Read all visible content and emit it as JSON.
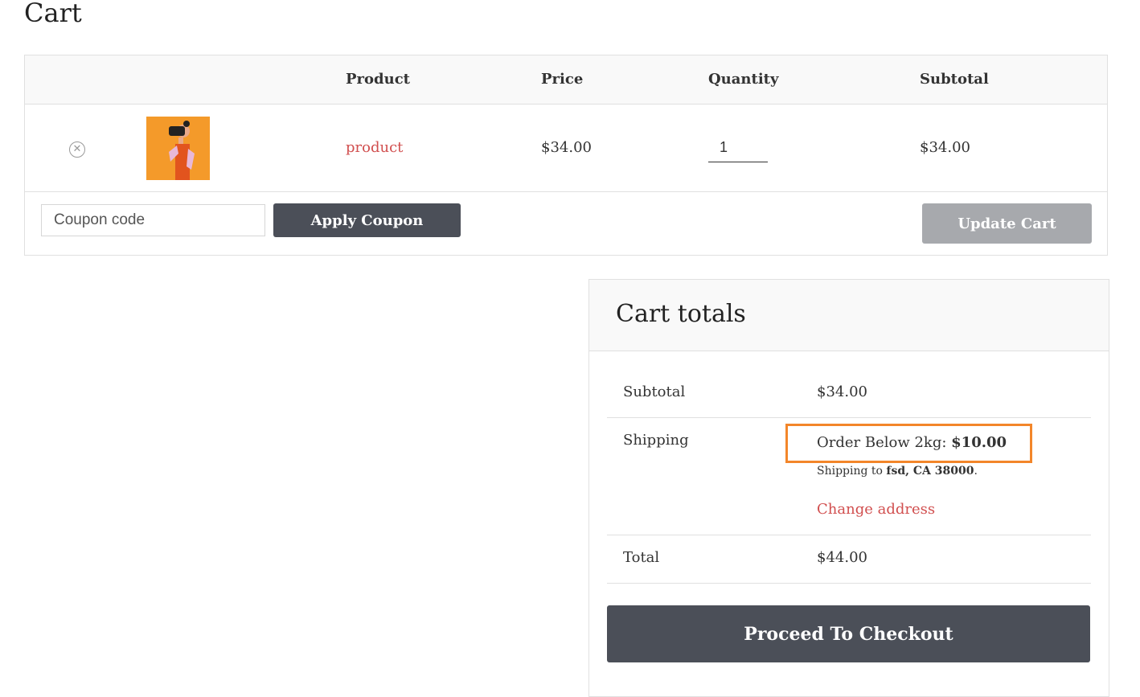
{
  "page": {
    "title": "Cart"
  },
  "cart": {
    "headers": {
      "product": "Product",
      "price": "Price",
      "quantity": "Quantity",
      "subtotal": "Subtotal"
    },
    "items": [
      {
        "name": "product",
        "price": "$34.00",
        "quantity": "1",
        "subtotal": "$34.00",
        "remove_icon": "remove-circle-x"
      }
    ],
    "coupon": {
      "placeholder": "Coupon code",
      "apply_label": "Apply Coupon"
    },
    "update_label": "Update Cart"
  },
  "totals": {
    "title": "Cart totals",
    "subtotal_label": "Subtotal",
    "subtotal_value": "$34.00",
    "shipping_label": "Shipping",
    "shipping_method": "Order Below 2kg: ",
    "shipping_cost": "$10.00",
    "shipping_to_prefix": "Shipping to ",
    "shipping_to_address": "fsd, CA 38000",
    "shipping_to_suffix": ".",
    "change_address_label": "Change address",
    "total_label": "Total",
    "total_value": "$44.00",
    "checkout_label": "Proceed To Checkout"
  },
  "colors": {
    "accent_link": "#d14f4f",
    "button_dark": "#4b4f58",
    "button_disabled": "#a7a9ad",
    "highlight_box": "#f3862a",
    "thumbnail_bg": "#f49a2a"
  }
}
